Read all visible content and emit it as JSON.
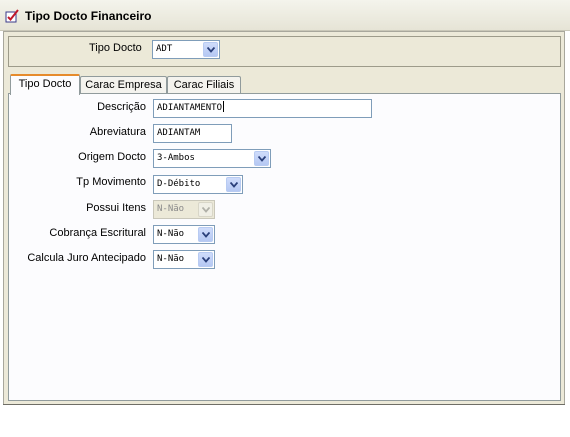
{
  "window": {
    "title": "Tipo Docto Financeiro",
    "icon": "edit-check-icon"
  },
  "header": {
    "tipo_docto_label": "Tipo Docto",
    "tipo_docto_value": "ADT"
  },
  "tabs": [
    {
      "label": "Tipo Docto",
      "active": true
    },
    {
      "label": "Carac Empresa",
      "active": false
    },
    {
      "label": "Carac Filiais",
      "active": false
    }
  ],
  "form": {
    "descricao": {
      "label": "Descrição",
      "value": "ADIANTAMENTO"
    },
    "abreviatura": {
      "label": "Abreviatura",
      "value": "ADIANTAM"
    },
    "origem_docto": {
      "label": "Origem Docto",
      "value": "3-Ambos"
    },
    "tp_movimento": {
      "label": "Tp Movimento",
      "value": "D-Débito"
    },
    "possui_itens": {
      "label": "Possui Itens",
      "value": "N-Não",
      "disabled": true
    },
    "cobranca_escritural": {
      "label": "Cobrança Escritural",
      "value": "N-Não"
    },
    "calcula_juro": {
      "label": "Calcula Juro Antecipado",
      "value": "N-Não"
    }
  },
  "colors": {
    "accent_tab": "#e68b2c",
    "field_border": "#7f9db9",
    "panel_bg": "#ece9d8"
  }
}
